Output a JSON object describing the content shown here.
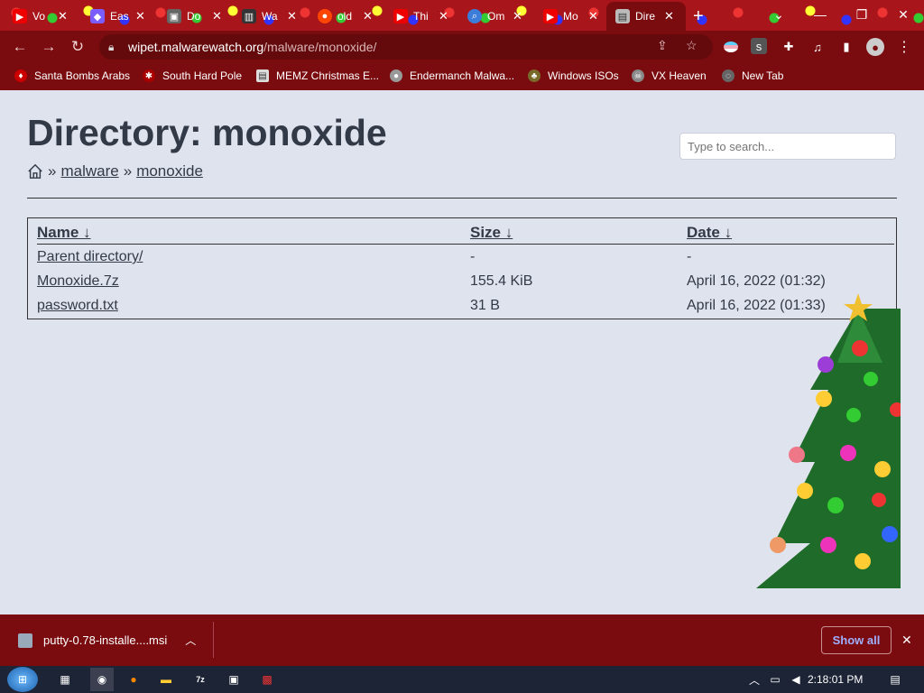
{
  "tabs": [
    {
      "label": "Vo",
      "icon": "youtube-icon"
    },
    {
      "label": "Eas",
      "icon": "app-icon"
    },
    {
      "label": "Do",
      "icon": "putty-icon"
    },
    {
      "label": "Wa",
      "icon": "archive-icon"
    },
    {
      "label": "old",
      "icon": "reddit-icon"
    },
    {
      "label": "Thi",
      "icon": "youtube-icon"
    },
    {
      "label": "Om",
      "icon": "search-icon"
    },
    {
      "label": "Mo",
      "icon": "youtube-icon"
    },
    {
      "label": "Dire",
      "icon": "page-icon"
    }
  ],
  "address": {
    "host": "wipet.malwarewatch.org",
    "path": "/malware/monoxide/"
  },
  "bookmarks": [
    "Santa Bombs Arabs",
    "South Hard Pole",
    "MEMZ Christmas E...",
    "Endermanch Malwa...",
    "Windows ISOs",
    "VX Heaven",
    "New Tab"
  ],
  "page": {
    "title": "Directory: monoxide",
    "breadcrumb": {
      "sep": "»",
      "items": [
        "malware",
        "monoxide"
      ]
    },
    "search": {
      "placeholder": "Type to search..."
    },
    "headers": {
      "name": "Name ↓",
      "size": "Size ↓",
      "date": "Date ↓"
    },
    "rows": [
      {
        "name": "Parent directory/",
        "size": "-",
        "date": "-"
      },
      {
        "name": "Monoxide.7z",
        "size": "155.4 KiB",
        "date": "April 16, 2022 (01:32)"
      },
      {
        "name": "password.txt",
        "size": "31 B",
        "date": "April 16, 2022 (01:33)"
      }
    ]
  },
  "download": {
    "file": "putty-0.78-installe....msi",
    "show_all": "Show all"
  },
  "taskbar": {
    "time": "2:18:01 PM"
  },
  "colors": {
    "chrome": "#7a0c10",
    "page_bg": "#dfe3ed",
    "text": "#333a47"
  }
}
